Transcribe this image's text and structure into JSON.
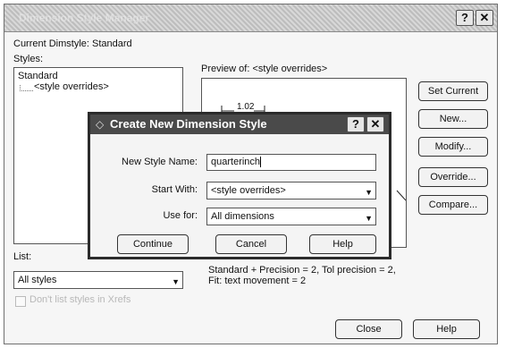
{
  "window": {
    "title": "Dimension Style Manager",
    "help_glyph": "?",
    "close_glyph": "✕",
    "current_label": "Current Dimstyle: Standard",
    "styles_label": "Styles:",
    "styles": [
      "Standard",
      "<style overrides>"
    ],
    "preview_label": "Preview of: <style overrides>",
    "preview_dim": "1.02",
    "list_label": "List:",
    "list_value": "All styles",
    "dont_list_label": "Don't list styles in Xrefs",
    "description": [
      "Standard + Precision = 2, Tol precision = 2,",
      "Fit: text movement = 2"
    ],
    "buttons": {
      "set_current": "Set Current",
      "new": "New...",
      "modify": "Modify...",
      "override": "Override...",
      "compare": "Compare...",
      "close": "Close",
      "help": "Help"
    }
  },
  "dialog": {
    "title": "Create New Dimension Style",
    "help_glyph": "?",
    "close_glyph": "✕",
    "new_style_label": "New Style Name:",
    "new_style_value": "quarterinch",
    "start_with_label": "Start With:",
    "start_with_value": "<style overrides>",
    "use_for_label": "Use for:",
    "use_for_value": "All dimensions",
    "buttons": {
      "continue": "Continue",
      "cancel": "Cancel",
      "help": "Help"
    }
  },
  "icons": {
    "dropdown": "chevron-down-icon",
    "checkbox": "checkbox-icon"
  }
}
